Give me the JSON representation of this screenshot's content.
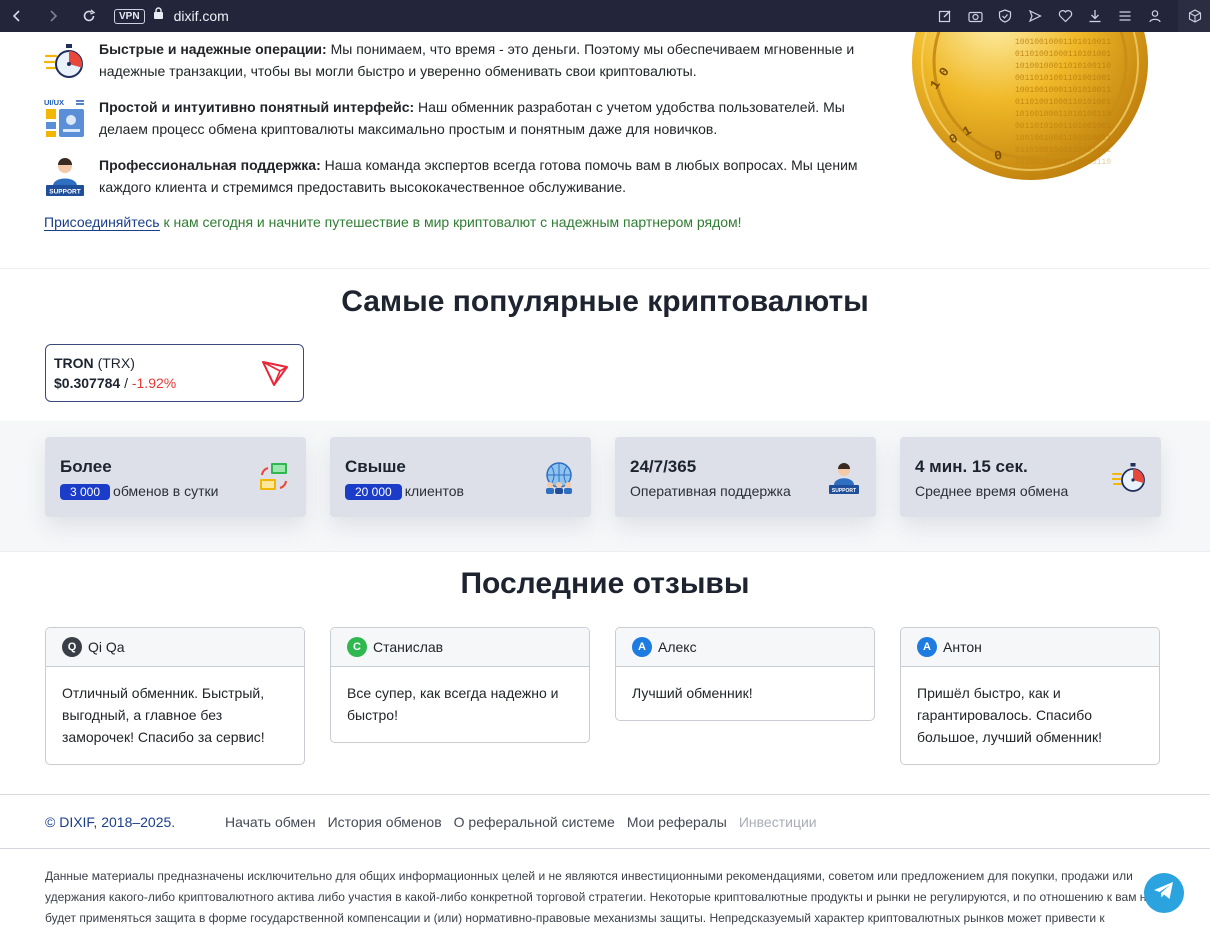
{
  "browser": {
    "vpn_label": "VPN",
    "url": "dixif.com"
  },
  "features": [
    {
      "title": "Быстрые и надежные операции:",
      "text": " Мы понимаем, что время - это деньги. Поэтому мы обеспечиваем мгновенные и надежные транзакции, чтобы вы могли быстро и уверенно обменивать свои криптовалюты.",
      "icon": "stopwatch-icon"
    },
    {
      "title": "Простой и интуитивно понятный интерфейс:",
      "text": " Наш обменник разработан с учетом удобства пользователей. Мы делаем процесс обмена криптовалюты максимально простым и понятным даже для новичков.",
      "icon": "ui-ux-icon",
      "icon_label": "UI/UX"
    },
    {
      "title": "Профессиональная поддержка:",
      "text": " Наша команда экспертов всегда готова помочь вам в любых вопросах. Мы ценим каждого клиента и стремимся предоставить высококачественное обслуживание.",
      "icon": "support-agent-icon",
      "icon_label": "SUPPORT"
    }
  ],
  "join": {
    "link": "Присоединяйтесь",
    "text": " к нам сегодня и начните путешествие в мир криптовалют с надежным партнером рядом!"
  },
  "popular": {
    "heading": "Самые популярные криптовалюты",
    "card": {
      "name": "TRON",
      "ticker": "(TRX)",
      "price": "$0.307784",
      "separator": " / ",
      "change": "-1.92%",
      "icon": "tron-icon"
    }
  },
  "stats": [
    {
      "title": "Более",
      "badge": "3 000",
      "text": "обменов в сутки",
      "icon": "exchange-screens-icon"
    },
    {
      "title": "Свыше",
      "badge": "20 000",
      "text": "клиентов",
      "icon": "globe-people-icon"
    },
    {
      "title": "24/7/365",
      "badge": "",
      "text": "Оперативная поддержка",
      "icon": "support-agent-icon"
    },
    {
      "title": "4 мин. 15 сек.",
      "badge": "",
      "text": "Среднее время обмена",
      "icon": "stopwatch-icon"
    }
  ],
  "reviews": {
    "heading": "Последние отзывы",
    "items": [
      {
        "initial": "Q",
        "name": "Qi Qa",
        "text": "Отличный обменник. Быстрый, выгодный, а главное без заморочек! Спасибо за сервис!",
        "color": "#3a3f47"
      },
      {
        "initial": "С",
        "name": "Станислав",
        "text": "Все супер, как всегда надежно и быстро!",
        "color": "#2fb84f"
      },
      {
        "initial": "А",
        "name": "Алекс",
        "text": "Лучший обменник!",
        "color": "#1e7be0"
      },
      {
        "initial": "А",
        "name": "Антон",
        "text": "Пришёл быстро, как и гарантировалось. Спасибо большое, лучший обменник!",
        "color": "#1e7be0"
      }
    ]
  },
  "footer": {
    "copyright": "© DIXIF, 2018–2025.",
    "links": [
      "Начать обмен",
      "История обменов",
      "О реферальной системе",
      "Мои рефералы",
      "Инвестиции"
    ],
    "disclaimer": "Данные материалы предназначены исключительно для общих информационных целей и не являются инвестиционными рекомендациями, советом или предложением для покупки, продажи или удержания какого-либо криптовалютного актива либо участия в какой-либо конкретной торговой стратегии. Некоторые криптовалютные продукты и рынки не регулируются, и по отношению к вам не будет применяться защита в форме государственной компенсации и (или) нормативно-правовые механизмы защиты. Непредсказуемый характер криптовалютных рынков может привести к"
  },
  "colors": {
    "accent": "#1a3cc8",
    "link": "#1a3e8c",
    "negative": "#e53935",
    "telegram": "#2aa3df"
  }
}
